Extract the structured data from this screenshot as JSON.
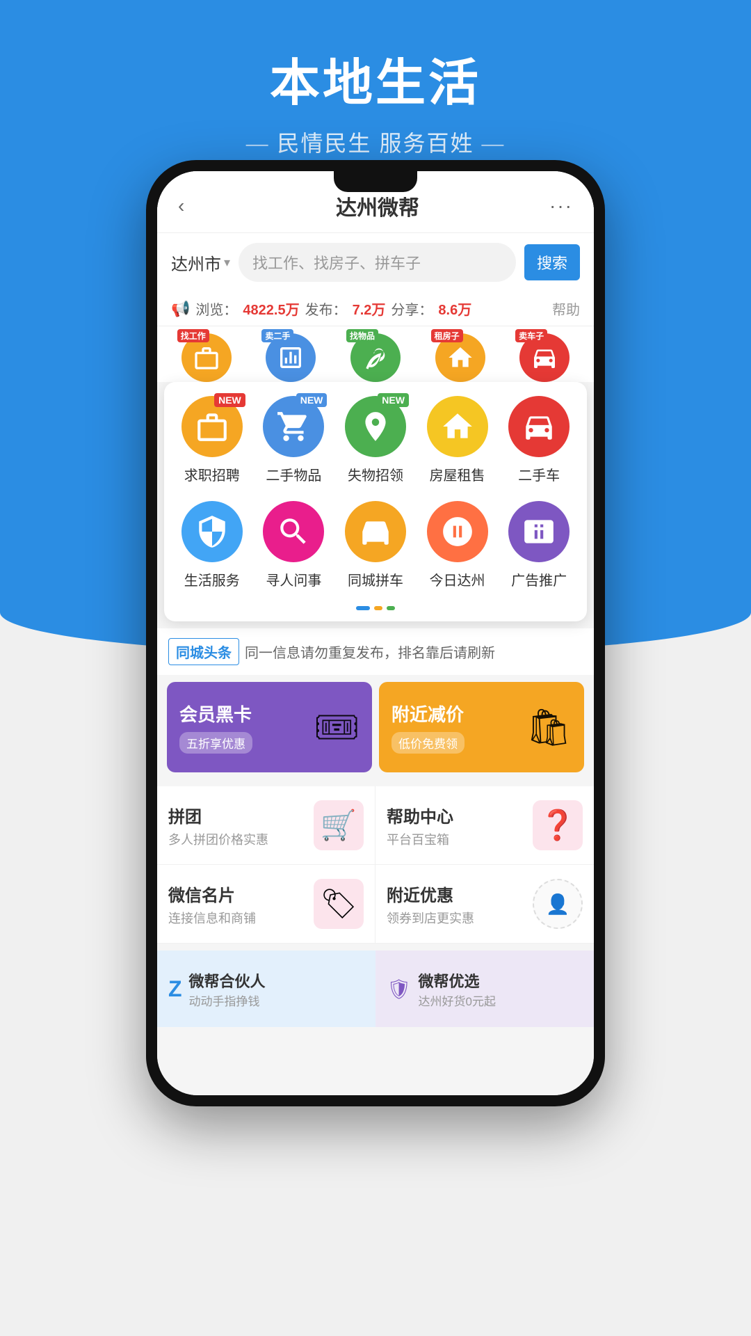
{
  "page": {
    "title": "本地生活",
    "subtitle": "民情民生 服务百姓"
  },
  "appbar": {
    "back": "‹",
    "title": "达州微帮",
    "more": "···"
  },
  "search": {
    "city": "达州市",
    "placeholder": "找工作、找房子、拼车子",
    "button": "搜索"
  },
  "stats": {
    "icon": "📢",
    "browse_label": "浏览：",
    "browse_value": "4822.5万",
    "publish_label": "发布：",
    "publish_value": "7.2万",
    "share_label": "分享：",
    "share_value": "8.6万",
    "help": "帮助"
  },
  "top_categories": [
    {
      "label": "找工作",
      "color": "orange",
      "badge": "找工作",
      "badge_color": "red"
    },
    {
      "label": "卖二手",
      "color": "blue",
      "badge": "卖二手",
      "badge_color": "blue"
    },
    {
      "label": "找物品",
      "color": "green",
      "badge": "找物品",
      "badge_color": "green"
    },
    {
      "label": "租房子",
      "color": "yellow",
      "badge": "租房子",
      "badge_color": "red"
    },
    {
      "label": "卖车子",
      "color": "red",
      "badge": "卖车子",
      "badge_color": "red"
    }
  ],
  "main_categories": [
    {
      "label": "求职招聘",
      "color": "orange",
      "badge": "NEW",
      "badge_color": "red"
    },
    {
      "label": "二手物品",
      "color": "blue",
      "badge": "NEW",
      "badge_color": "blue"
    },
    {
      "label": "失物招领",
      "color": "green",
      "badge": "NEW",
      "badge_color": "green"
    },
    {
      "label": "房屋租售",
      "color": "yellow",
      "badge": null
    },
    {
      "label": "二手车",
      "color": "red",
      "badge": null
    }
  ],
  "main_categories_row2": [
    {
      "label": "生活服务",
      "color": "blue2",
      "badge": null
    },
    {
      "label": "寻人问事",
      "color": "pink",
      "badge": null
    },
    {
      "label": "同城拼车",
      "color": "orange",
      "badge": null
    },
    {
      "label": "今日达州",
      "color": "orange",
      "badge": null
    },
    {
      "label": "广告推广",
      "color": "purple",
      "badge": null
    }
  ],
  "headlines": {
    "tag": "同城头条",
    "text": "同一信息请勿重复发布，排名靠后请刷新"
  },
  "promo_cards": [
    {
      "title": "会员黑卡",
      "subtitle": "五折享优惠",
      "color": "purple",
      "icon": "🎟"
    },
    {
      "title": "附近减价",
      "subtitle": "低价免费领",
      "color": "orange",
      "icon": "🛍"
    }
  ],
  "features": [
    {
      "title": "拼团",
      "desc": "多人拼团价格实惠",
      "icon": "🛒",
      "icon_color": "red"
    },
    {
      "title": "帮助中心",
      "desc": "平台百宝箱",
      "icon": "❓",
      "icon_color": "pink"
    },
    {
      "title": "微信名片",
      "desc": "连接信息和商铺",
      "icon": "🏷",
      "icon_color": "pink"
    },
    {
      "title": "附近优惠",
      "desc": "领券到店更实惠",
      "icon": "👤",
      "icon_color": "gray"
    }
  ],
  "bottom_banners": [
    {
      "icon_text": "Z",
      "title": "微帮合伙人",
      "subtitle": "动动手指挣钱",
      "style": "blue"
    },
    {
      "icon_text": "✓",
      "title": "微帮优选",
      "subtitle": "达州好货0元起",
      "style": "purple"
    }
  ]
}
